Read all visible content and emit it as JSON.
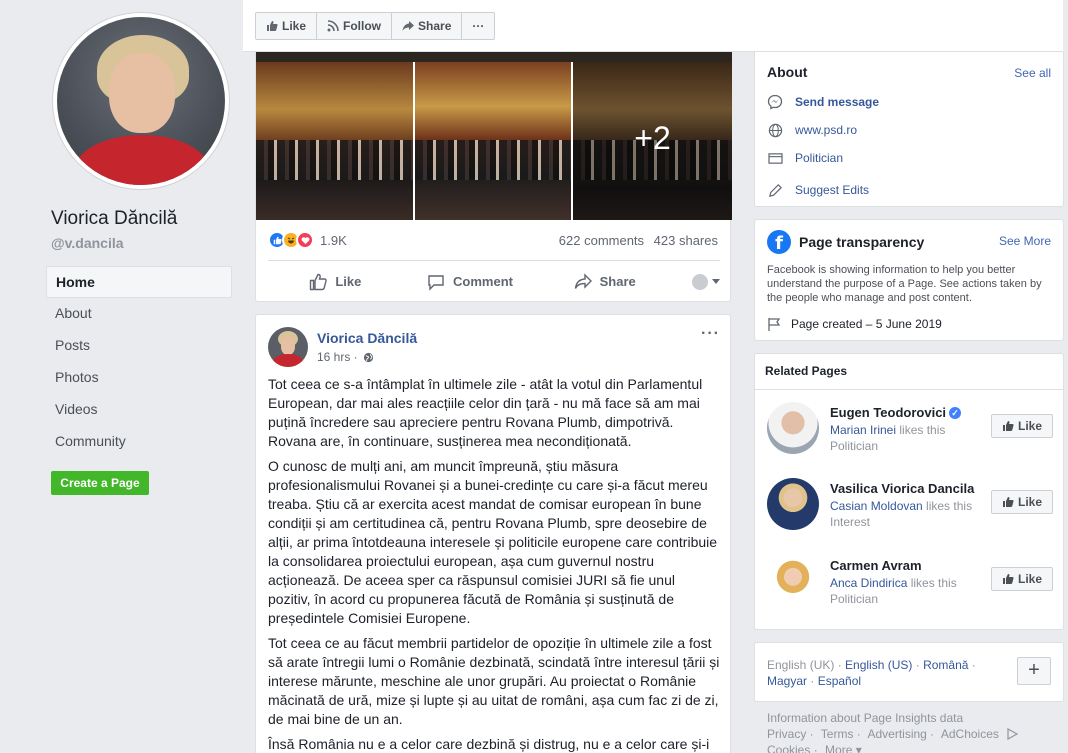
{
  "left": {
    "page_name": "Viorica Dăncilă",
    "page_handle": "@v.dancila",
    "nav": [
      "Home",
      "About",
      "Posts",
      "Photos",
      "Videos",
      "Community"
    ],
    "create_page": "Create a Page"
  },
  "topbar": {
    "like": "Like",
    "follow": "Follow",
    "share": "Share",
    "more": "···"
  },
  "post1": {
    "photo_more": "+2",
    "reaction_count": "1.9K",
    "comments": "622 comments",
    "shares": "423 shares",
    "actions": {
      "like": "Like",
      "comment": "Comment",
      "share": "Share"
    }
  },
  "post2": {
    "author": "Viorica Dăncilă",
    "time": "16 hrs · ",
    "more": "···",
    "paragraphs": [
      "Tot ceea ce s-a întâmplat în ultimele zile - atât la votul din Parlamentul European, dar mai ales reacțiile celor din țară - nu mă face să am mai puțină încredere sau apreciere pentru Rovana Plumb, dimpotrivă. Rovana are, în continuare, susținerea mea necondiționată.",
      "O cunosc de mulți ani, am muncit împreună, știu măsura profesionalismului Rovanei și a bunei-credințe cu care și-a făcut mereu treaba. Știu că ar exercita acest mandat de comisar european în bune condiții și am certitudinea că, pentru Rovana Plumb, spre deosebire de alții, ar prima întotdeauna interesele și politicile europene care contribuie la consolidarea proiectului european, așa cum guvernul nostru acționează. De aceea sper ca răspunsul comisiei JURI să fie unul pozitiv, în acord cu propunerea făcută de România și susținută de președintele Comisiei Europene.",
      "Tot ceea ce au făcut membrii partidelor de opoziție în ultimele zile a fost să arate întregii lumi o Românie dezbinată, scindată între interesul țării și interese mărunte, meschine ale unor grupări. Au proiectat o Românie măcinată de ură, mize și lupte și au uitat de români, așa cum fac zi de zi, de mai bine de un an.",
      "Însă România nu e a celor care dezbină și distrug, nu e a celor care și-i"
    ]
  },
  "about": {
    "title": "About",
    "see_all": "See all",
    "send_message": "Send message",
    "website": "www.psd.ro",
    "category": "Politician",
    "suggest_edits": "Suggest Edits"
  },
  "transparency": {
    "title": "Page transparency",
    "see_more": "See More",
    "description": "Facebook is showing information to help you better understand the purpose of a Page. See actions taken by the people who manage and post content.",
    "created": "Page created – 5 June 2019"
  },
  "related": {
    "title": "Related Pages",
    "items": [
      {
        "name": "Eugen Teodorovici",
        "friend": "Marian Irinei",
        "rest": " likes this Politician",
        "like": "Like"
      },
      {
        "name": "Vasilica Viorica Dancila",
        "friend": "Casian Moldovan",
        "rest": " likes this Interest",
        "like": "Like"
      },
      {
        "name": "Carmen Avram",
        "friend": "Anca Dindirica",
        "rest": " likes this Politician",
        "like": "Like"
      }
    ]
  },
  "languages": {
    "current": "English (UK)",
    "others": [
      "English (US)",
      "Română",
      "Magyar",
      "Español"
    ],
    "add": "+"
  },
  "footer": {
    "links": [
      "Information about Page Insights data",
      "Privacy ·",
      "Terms ·",
      "Advertising ·",
      "AdChoices",
      "Cookies ·",
      "More ▾"
    ]
  },
  "colors": {
    "link": "#365899",
    "brand": "#4267b2",
    "create_button": "#42b72a"
  }
}
